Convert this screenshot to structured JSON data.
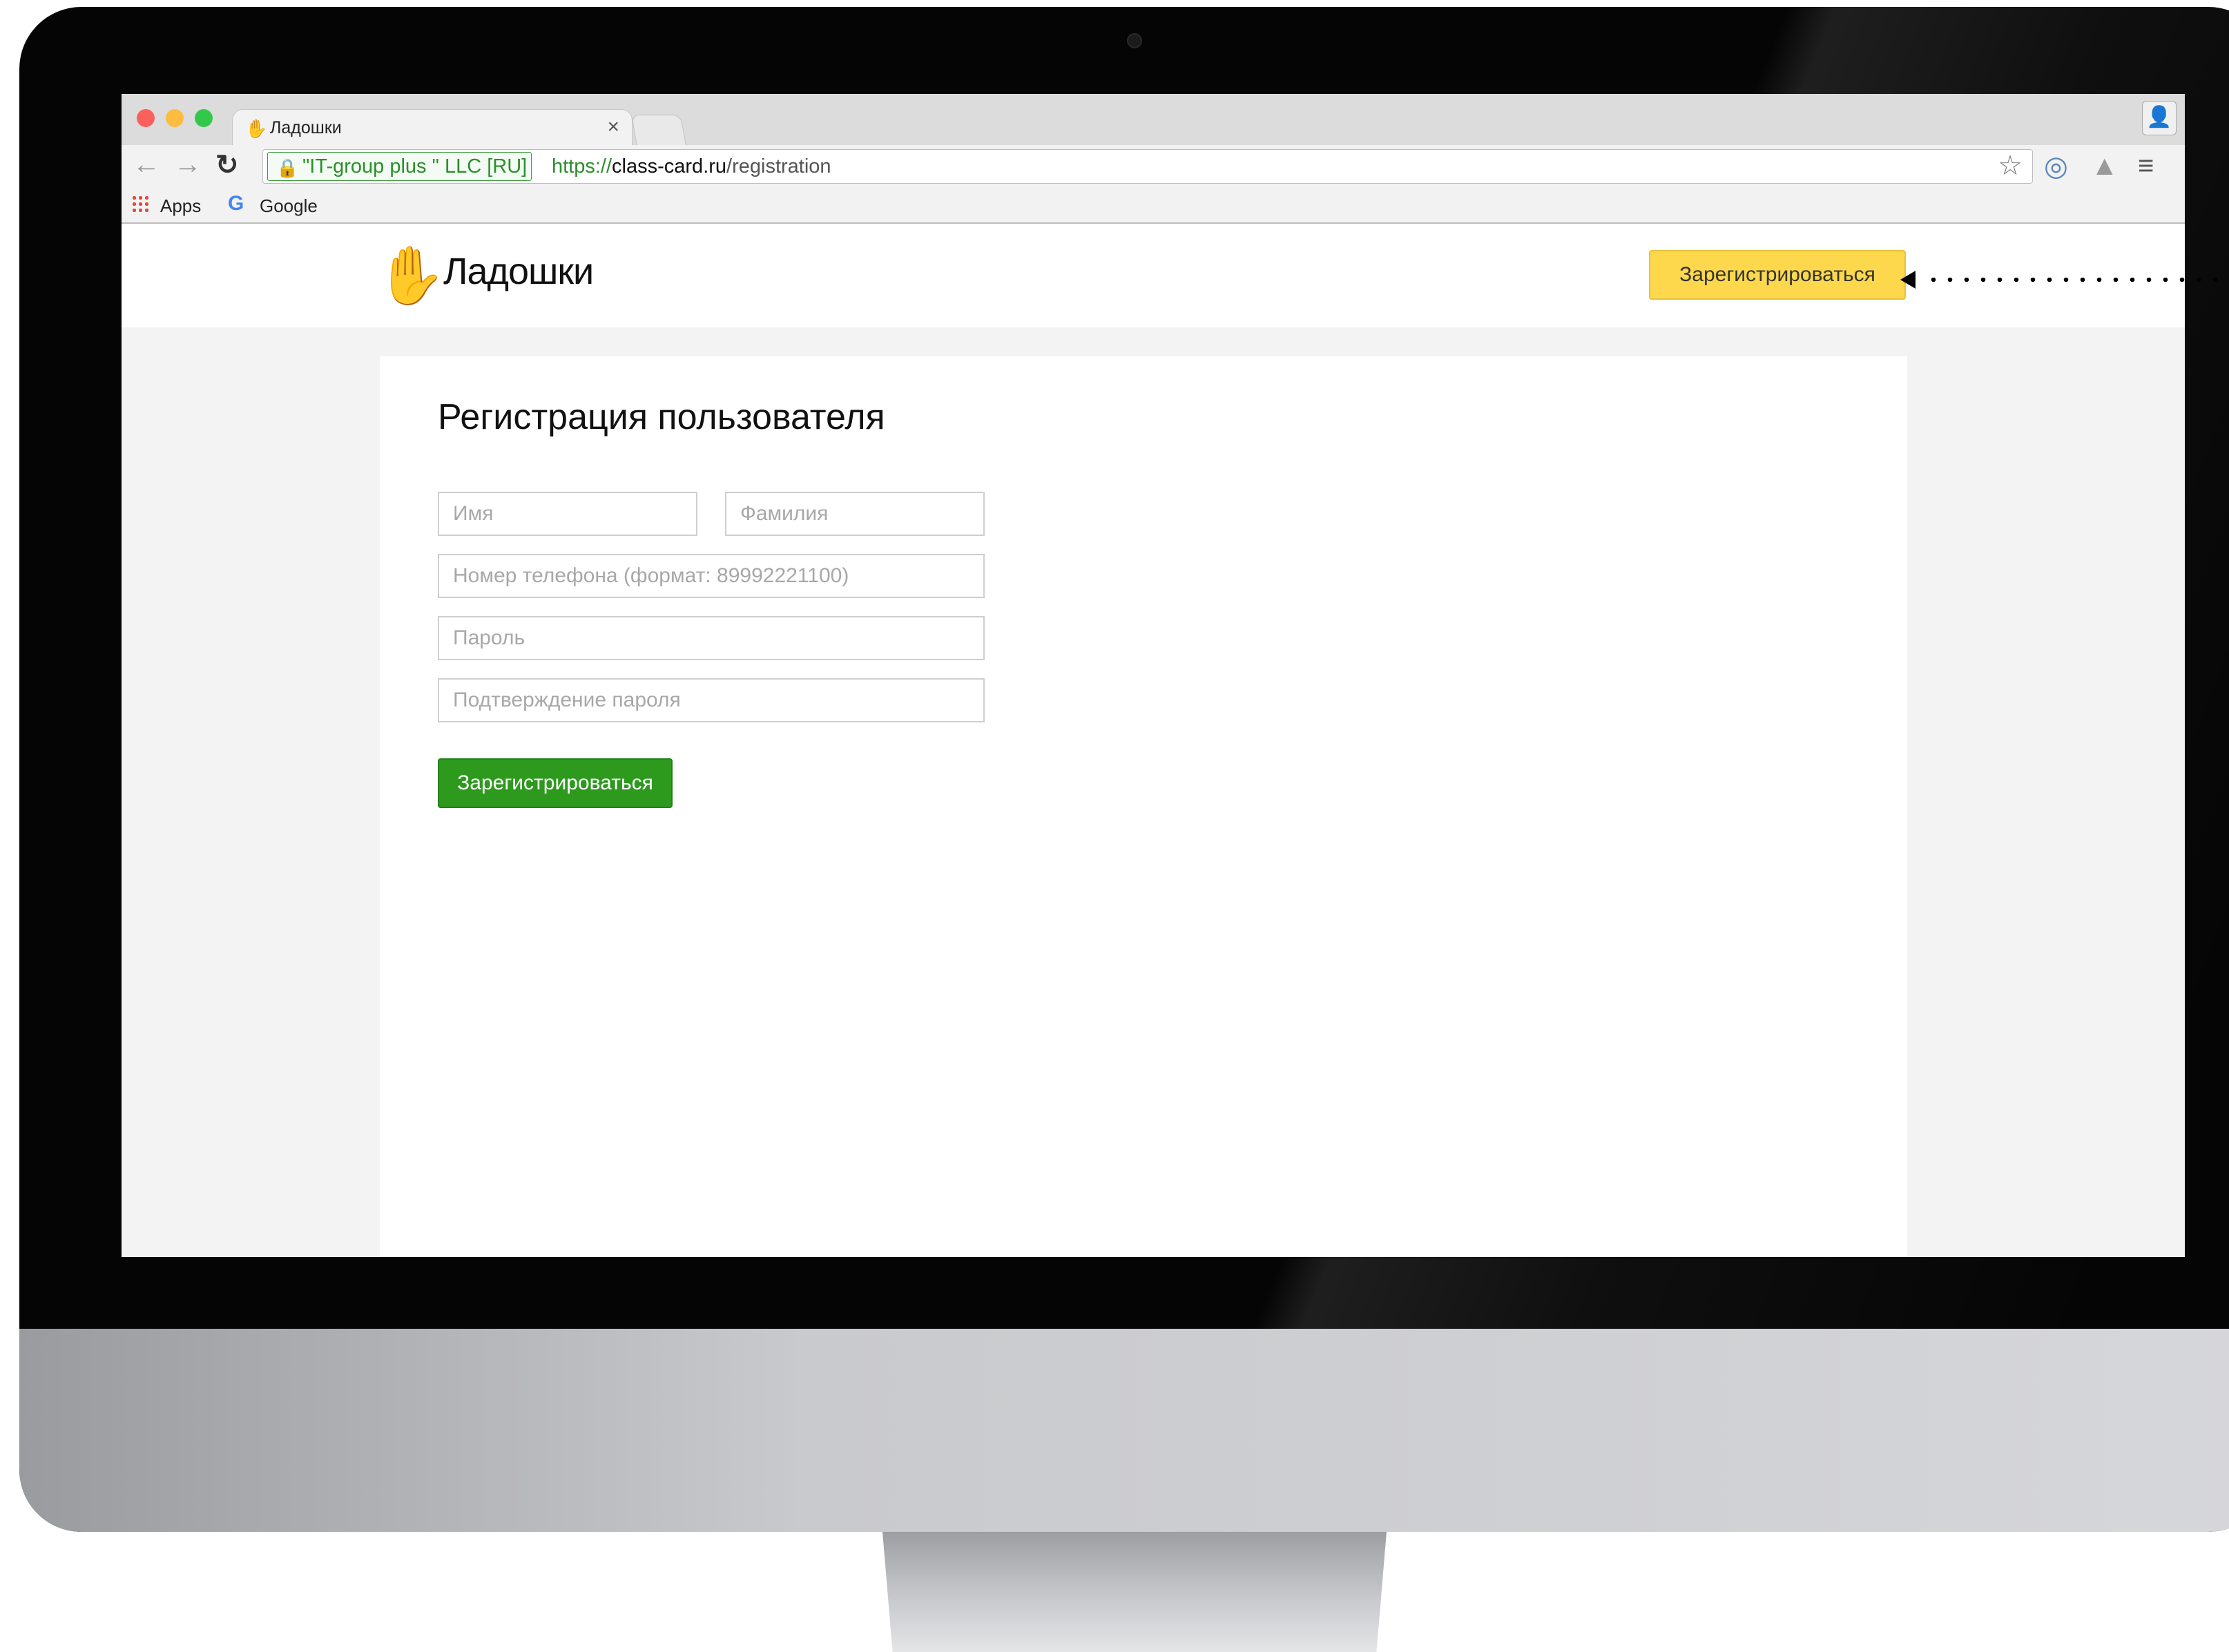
{
  "browser": {
    "tab_title": "Ладошки",
    "tab_close": "×",
    "ev_certificate": "\"IT-group plus \" LLC [RU]",
    "url_scheme": "https://",
    "url_host": "class-card.ru",
    "url_path": "/registration",
    "bookmarks": [
      {
        "label": "Apps",
        "icon": "apps-grid-icon"
      },
      {
        "label": "Google",
        "icon": "google-g-icon"
      }
    ]
  },
  "site": {
    "logo_text": "Ладошки",
    "logo_icon": "waving-hand-icon",
    "header_register_label": "Зарегистрироваться",
    "brand_yellow": "#fdd84c",
    "action_green": "#2d9a1e"
  },
  "form": {
    "title": "Регистрация пользователя",
    "first_name_placeholder": "Имя",
    "last_name_placeholder": "Фамилия",
    "phone_placeholder": "Номер телефона (формат: 89992221100)",
    "password_placeholder": "Пароль",
    "password_confirm_placeholder": "Подтверждение пароля",
    "submit_label": "Зарегистрироваться"
  }
}
